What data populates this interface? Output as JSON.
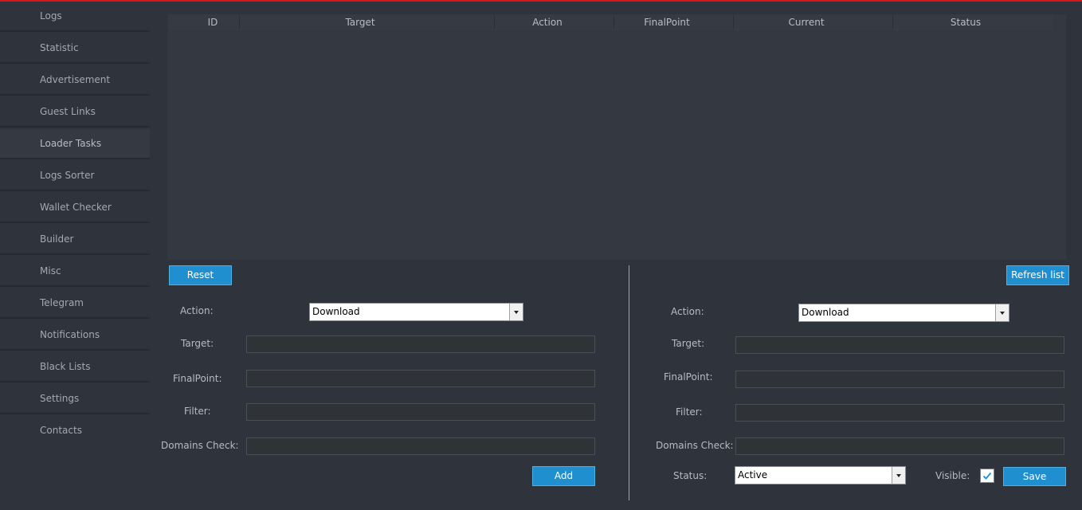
{
  "sidebar": {
    "items": [
      {
        "label": "Logs"
      },
      {
        "label": "Statistic"
      },
      {
        "label": "Advertisement"
      },
      {
        "label": "Guest Links"
      },
      {
        "label": "Loader Tasks"
      },
      {
        "label": "Logs Sorter"
      },
      {
        "label": "Wallet Checker"
      },
      {
        "label": "Builder"
      },
      {
        "label": "Misc"
      },
      {
        "label": "Telegram"
      },
      {
        "label": "Notifications"
      },
      {
        "label": "Black Lists"
      },
      {
        "label": "Settings"
      },
      {
        "label": "Contacts"
      }
    ],
    "active": "Loader Tasks"
  },
  "table": {
    "columns": [
      "ID",
      "Target",
      "Action",
      "FinalPoint",
      "Current",
      "Status"
    ],
    "rows": []
  },
  "left_form": {
    "reset_label": "Reset",
    "action_label": "Action:",
    "action_value": "Download",
    "target_label": "Target:",
    "target_value": "",
    "finalpoint_label": "FinalPoint:",
    "finalpoint_value": "",
    "filter_label": "Filter:",
    "filter_value": "",
    "domains_label": "Domains Check:",
    "domains_value": "",
    "add_label": "Add"
  },
  "right_form": {
    "refresh_label": "Refresh list",
    "action_label": "Action:",
    "action_value": "Download",
    "target_label": "Target:",
    "target_value": "",
    "finalpoint_label": "FinalPoint:",
    "finalpoint_value": "",
    "filter_label": "Filter:",
    "filter_value": "",
    "domains_label": "Domains Check:",
    "domains_value": "",
    "status_label": "Status:",
    "status_value": "Active",
    "visible_label": "Visible:",
    "visible_checked": true,
    "save_label": "Save"
  },
  "colors": {
    "accent": "#1f8fd0",
    "topline": "#d6161b",
    "background": "#2f343c"
  }
}
